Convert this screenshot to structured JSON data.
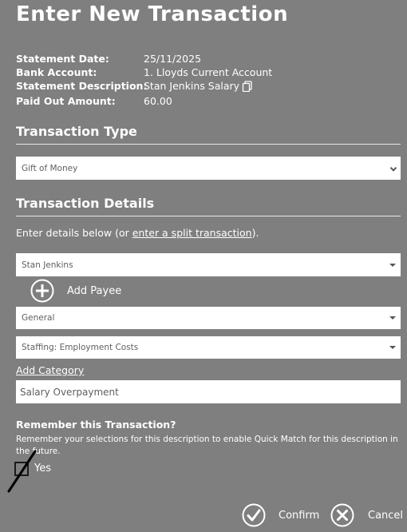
{
  "title": "Enter New Transaction",
  "summary": {
    "statement_date_label": "Statement Date:",
    "statement_date_value": "25/11/2025",
    "bank_account_label": "Bank Account:",
    "bank_account_value": "1. Lloyds Current Account",
    "description_label": "Statement Description:",
    "description_value": "Stan Jenkins Salary",
    "paid_out_label": "Paid Out Amount:",
    "paid_out_value": "60.00"
  },
  "transaction_type": {
    "heading": "Transaction Type",
    "selected": "Gift of Money"
  },
  "transaction_details": {
    "heading": "Transaction Details",
    "intro_prefix": "Enter details below (or ",
    "intro_link": "enter a split transaction",
    "intro_suffix": ").",
    "payee": "Stan Jenkins",
    "add_payee_label": "Add Payee",
    "category_group": "General",
    "category": "Staffing: Employment Costs",
    "add_category_label": "Add Category",
    "memo_value": "Salary Overpayment"
  },
  "remember": {
    "heading": "Remember this Transaction?",
    "description": "Remember your selections for this description to enable Quick Match for this description in the future.",
    "checkbox_label": "Yes",
    "checked": false
  },
  "actions": {
    "confirm_label": "Confirm",
    "cancel_label": "Cancel"
  },
  "icons": {
    "copy": "copy-icon",
    "add": "plus-circle-icon",
    "confirm": "check-circle-icon",
    "cancel": "x-circle-icon"
  }
}
